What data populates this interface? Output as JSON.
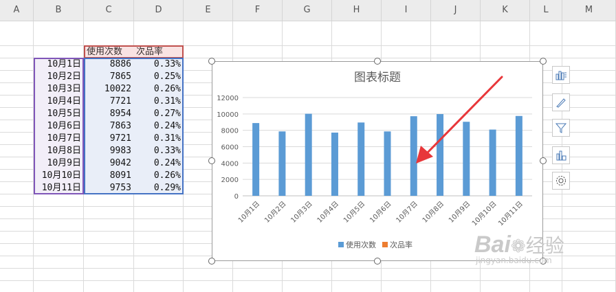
{
  "sheet": {
    "columns": [
      "A",
      "B",
      "C",
      "D",
      "E",
      "F",
      "G",
      "H",
      "I",
      "J",
      "K",
      "L",
      "M"
    ]
  },
  "table": {
    "headers": [
      "使用次数",
      "次品率"
    ],
    "rows": [
      {
        "date": "10月1日",
        "uses": "8886",
        "defect": "0.33%"
      },
      {
        "date": "10月2日",
        "uses": "7865",
        "defect": "0.25%"
      },
      {
        "date": "10月3日",
        "uses": "10022",
        "defect": "0.26%"
      },
      {
        "date": "10月4日",
        "uses": "7721",
        "defect": "0.31%"
      },
      {
        "date": "10月5日",
        "uses": "8954",
        "defect": "0.27%"
      },
      {
        "date": "10月6日",
        "uses": "7863",
        "defect": "0.24%"
      },
      {
        "date": "10月7日",
        "uses": "9721",
        "defect": "0.31%"
      },
      {
        "date": "10月8日",
        "uses": "9983",
        "defect": "0.33%"
      },
      {
        "date": "10月9日",
        "uses": "9042",
        "defect": "0.24%"
      },
      {
        "date": "10月10日",
        "uses": "8091",
        "defect": "0.26%"
      },
      {
        "date": "10月11日",
        "uses": "9753",
        "defect": "0.29%"
      }
    ]
  },
  "chart_data": {
    "type": "bar",
    "title": "图表标题",
    "categories": [
      "10月1日",
      "10月2日",
      "10月3日",
      "10月4日",
      "10月5日",
      "10月6日",
      "10月7日",
      "10月8日",
      "10月9日",
      "10月10日",
      "10月11日"
    ],
    "series": [
      {
        "name": "使用次数",
        "values": [
          8886,
          7865,
          10022,
          7721,
          8954,
          7863,
          9721,
          9983,
          9042,
          8091,
          9753
        ],
        "color": "#5b9bd5"
      },
      {
        "name": "次品率",
        "values": [
          0.0033,
          0.0025,
          0.0026,
          0.0031,
          0.0027,
          0.0024,
          0.0031,
          0.0033,
          0.0024,
          0.0026,
          0.0029
        ],
        "color": "#ed7d31"
      }
    ],
    "ylim": [
      0,
      12000
    ],
    "yticks": [
      "0",
      "2000",
      "4000",
      "6000",
      "8000",
      "10000",
      "12000"
    ],
    "grid": true,
    "legend": "bottom"
  },
  "watermark": {
    "brand": "Bai",
    "brand2": "经验",
    "url": "jingyan.baidu.com"
  },
  "colors": {
    "accent": "#5b9bd5",
    "secondary": "#ed7d31",
    "arrow": "#e8373a"
  }
}
